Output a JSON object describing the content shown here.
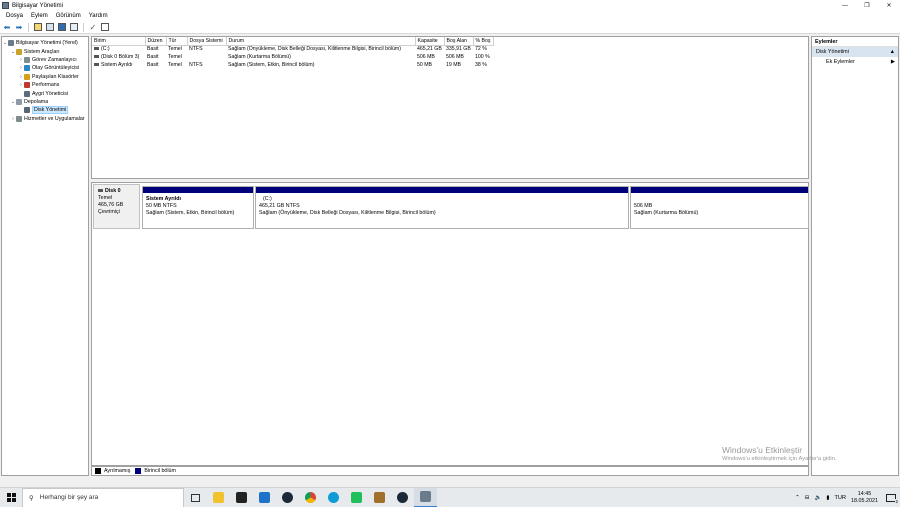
{
  "window": {
    "title": "Bilgisayar Yönetimi"
  },
  "menu": [
    "Dosya",
    "Eylem",
    "Görünüm",
    "Yardım"
  ],
  "tree": [
    {
      "label": "Bilgisayar Yönetimi (Yerel)",
      "indent": 0,
      "expander": "⌄",
      "color": "#6a7b8c"
    },
    {
      "label": "Sistem Araçları",
      "indent": 1,
      "expander": "⌄",
      "color": "#c9a227"
    },
    {
      "label": "Görev Zamanlayıcı",
      "indent": 2,
      "expander": "›",
      "color": "#7f8c8d"
    },
    {
      "label": "Olay Görüntüleyicisi",
      "indent": 2,
      "expander": "›",
      "color": "#2e86c1"
    },
    {
      "label": "Paylaşılan Klasörler",
      "indent": 2,
      "expander": "›",
      "color": "#d4a017"
    },
    {
      "label": "Performans",
      "indent": 2,
      "expander": "›",
      "color": "#c0392b"
    },
    {
      "label": "Aygıt Yöneticisi",
      "indent": 2,
      "expander": "",
      "color": "#5d6d7e"
    },
    {
      "label": "Depolama",
      "indent": 1,
      "expander": "⌄",
      "color": "#8e9aa6"
    },
    {
      "label": "Disk Yönetimi",
      "indent": 2,
      "expander": "",
      "color": "#566573",
      "selected": true
    },
    {
      "label": "Hizmetler ve Uygulamalar",
      "indent": 1,
      "expander": "›",
      "color": "#7f8c8d"
    }
  ],
  "volumes": {
    "headers": [
      "Birim",
      "Düzen",
      "Tür",
      "Dosya Sistemi",
      "Durum",
      "Kapasite",
      "Boş Alan",
      "% Boş"
    ],
    "rows": [
      [
        "(C:)",
        "Basit",
        "Temel",
        "NTFS",
        "Sağlam (Önyükleme, Disk Belleği Dosyası, Kilitlenme Bilgisi, Birincil bölüm)",
        "465,21 GB",
        "335,91 GB",
        "72 %"
      ],
      [
        "(Disk 0 Bölüm 3)",
        "Basit",
        "Temel",
        "",
        "Sağlam (Kurtarma Bölümü)",
        "506 MB",
        "506 MB",
        "100 %"
      ],
      [
        "Sistem Ayrıldı",
        "Basit",
        "Temel",
        "NTFS",
        "Sağlam (Sistem, Etkin, Birincil bölüm)",
        "50 MB",
        "19 MB",
        "38 %"
      ]
    ]
  },
  "disk": {
    "name": "Disk 0",
    "type": "Temel",
    "size": "465,76 GB",
    "status": "Çevrimiçi",
    "partitions": [
      {
        "name": "Sistem Ayrıldı",
        "size": "50 MB NTFS",
        "status": "Sağlam (Sistem, Etkin, Birincil bölüm)"
      },
      {
        "name": "(C:)",
        "size": "465,21 GB NTFS",
        "status": "Sağlam (Önyükleme, Disk Belleği Dosyası, Kilitlenme Bilgisi, Birincil bölüm)"
      },
      {
        "name": "",
        "size": "506 MB",
        "status": "Sağlam (Kurtarma Bölümü)"
      }
    ]
  },
  "legend": {
    "unallocated": "Ayrılmamış",
    "primary": "Birincil bölüm",
    "unallocated_color": "#000000",
    "primary_color": "#00007b"
  },
  "actions": {
    "header": "Eylemler",
    "section": "Disk Yönetimi",
    "more": "Ek Eylemler"
  },
  "watermark": {
    "line1": "Windows'u Etkinleştir",
    "line2": "Windows'u etkinleştirmek için Ayarlar'a gidin."
  },
  "taskbar": {
    "search_placeholder": "Herhangi bir şey ara",
    "language": "TUR",
    "time": "14:45",
    "date": "18.05.2021",
    "notification_count": "2"
  }
}
